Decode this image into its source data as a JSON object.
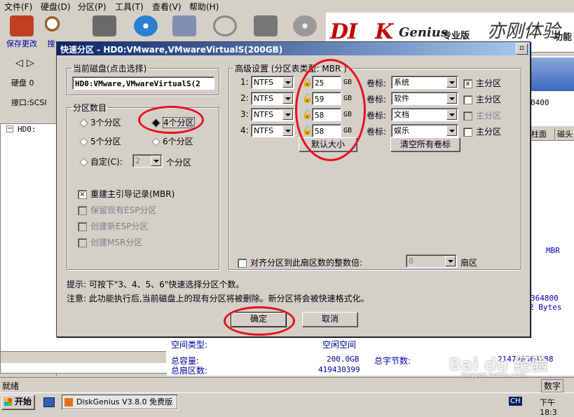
{
  "menu": [
    "文件(F)",
    "硬盘(D)",
    "分区(P)",
    "工具(T)",
    "查看(V)",
    "帮助(H)"
  ],
  "toolbar": {
    "save_label": "保存更改",
    "search_label": "搜"
  },
  "logo": {
    "brand": "DI",
    "brand2": "K",
    "genius": "Genius",
    "pro": "专业版",
    "handwriting": "亦刚体验",
    "func": "功能"
  },
  "leftpane": {
    "disk_label": "硬盘 0",
    "iface_label": "接口:SCSI",
    "tree_item": "HD0:"
  },
  "behind": {
    "num_0400": "0400",
    "col_head": "柱面",
    "col_head2": "磁头",
    "mbr": "MBR",
    "bytes1": "364800",
    "bytes2": "2 Bytes"
  },
  "info": {
    "space_type_label": "空间类型:",
    "space_type_value": "空闲空间",
    "total_cap_label": "总容量:",
    "total_cap_value": "200.0GB",
    "total_bytes_label": "总字节数:",
    "total_bytes_value": "214748364288",
    "total_sectors_label": "总扇区数:",
    "total_sectors_value": "419430399"
  },
  "status": {
    "text": "就绪",
    "numlock": "数字"
  },
  "taskbar": {
    "start": "开始",
    "app": "DiskGenius V3.8.0 免费版",
    "ime": "CH",
    "clock": "下午 18:3"
  },
  "watermark": {
    "text": "Bai du 经验",
    "url": "jingyan.baidu.com"
  },
  "dialog": {
    "title": "快速分区 - HD0:VMware,VMwareVirtualS(200GB)",
    "current_disk_legend": "当前磁盘(点击选择)",
    "current_disk_value": "HD0:VMware,VMwareVirtualS(2",
    "count_legend": "分区数目",
    "radio_3": "3个分区",
    "radio_4": "4个分区",
    "radio_5": "5个分区",
    "radio_6": "6个分区",
    "radio_custom": "自定(C):",
    "custom_value": "2",
    "custom_unit": "个分区",
    "chk_rebuild_mbr": "重建主引导记录(MBR)",
    "chk_keep_esp": "保留现有ESP分区",
    "chk_new_esp": "创建新ESP分区",
    "chk_msr": "创建MSR分区",
    "advanced_legend": "高级设置 (分区表类型: MBR )",
    "rows": [
      {
        "num": "1:",
        "fs": "NTFS",
        "size": "25",
        "unit": "GB",
        "vol_label": "卷标:",
        "vol": "系统",
        "primary": "主分区",
        "primary_checked": "x"
      },
      {
        "num": "2:",
        "fs": "NTFS",
        "size": "59",
        "unit": "GB",
        "vol_label": "卷标:",
        "vol": "软件",
        "primary": "主分区",
        "primary_checked": ""
      },
      {
        "num": "3:",
        "fs": "NTFS",
        "size": "58",
        "unit": "GB",
        "vol_label": "卷标:",
        "vol": "文档",
        "primary": "主分区",
        "primary_checked": ""
      },
      {
        "num": "4:",
        "fs": "NTFS",
        "size": "58",
        "unit": "GB",
        "vol_label": "卷标:",
        "vol": "娱乐",
        "primary": "主分区",
        "primary_checked": ""
      }
    ],
    "default_size_btn": "默认大小",
    "clear_labels_btn": "清空所有卷标",
    "align_label": "对齐分区到此扇区数的整数倍:",
    "align_value": "8",
    "align_unit": "扇区",
    "tip1": "提示: 可按下\"3、4、5、6\"快速选择分区个数。",
    "tip2": "注意: 此功能执行后,当前磁盘上的现有分区将被删除。新分区将会被快速格式化。",
    "ok_btn": "确定",
    "cancel_btn": "取消"
  }
}
